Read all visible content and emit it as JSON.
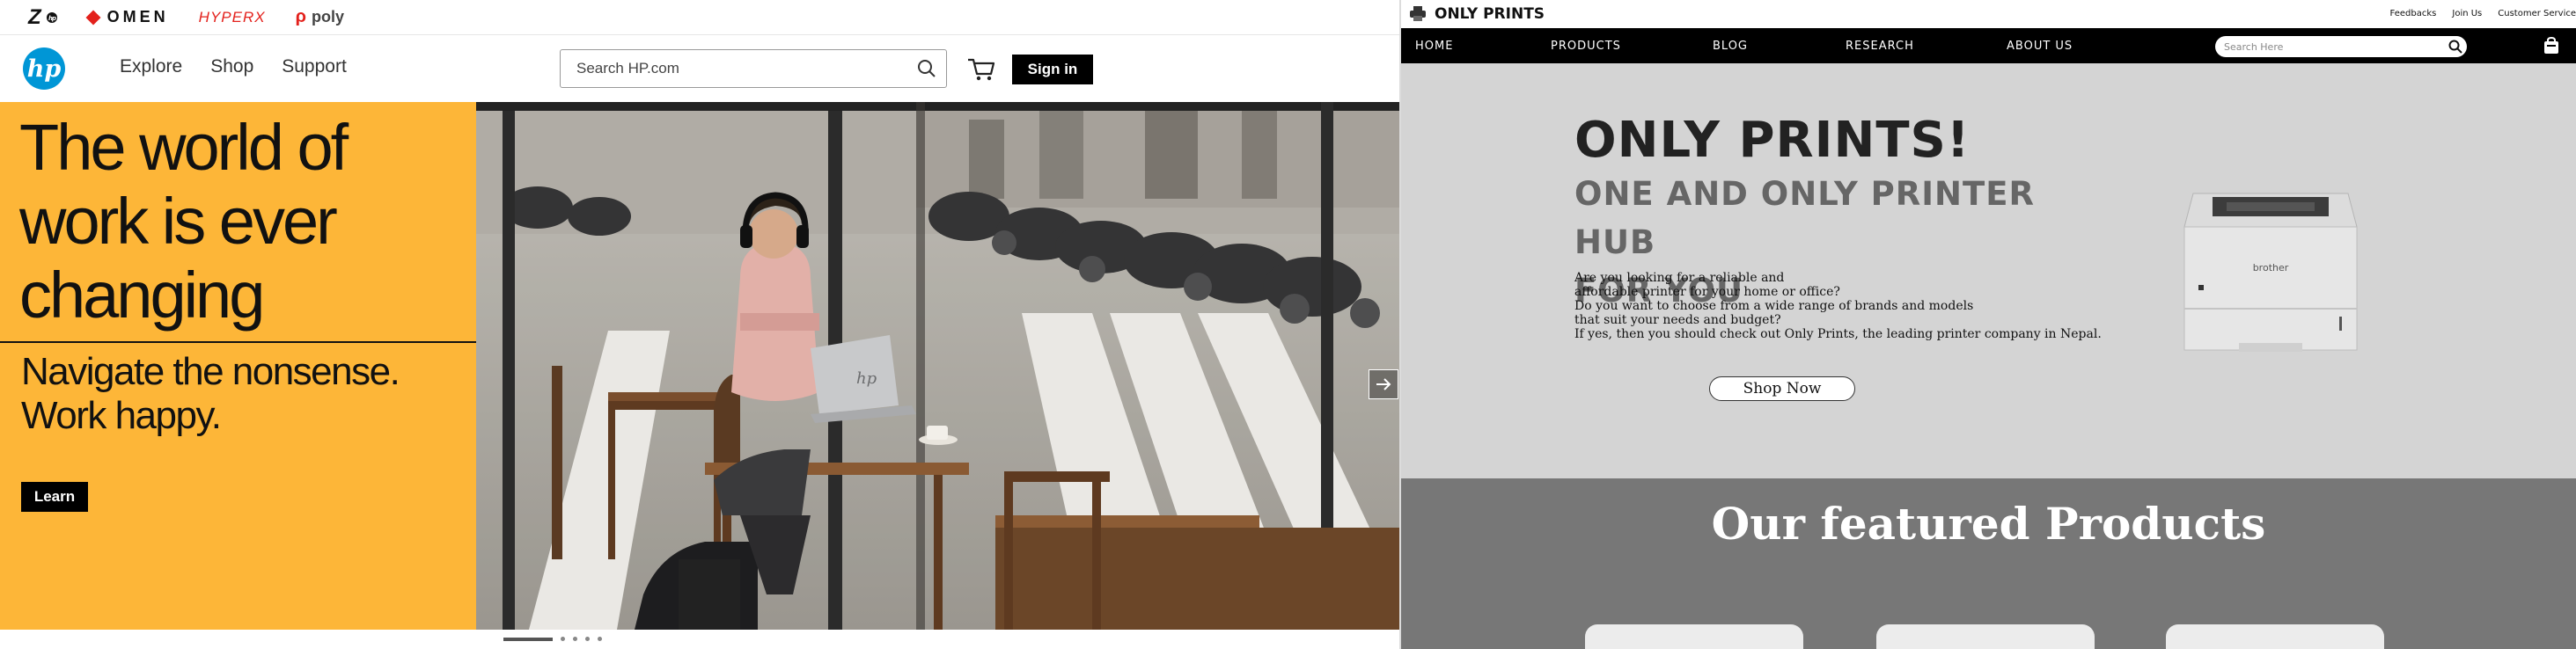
{
  "hp": {
    "brands": {
      "z": "Z",
      "omen": "OMEN",
      "hyperx": "HYPERX",
      "poly": "poly"
    },
    "logo_text": "hp",
    "nav": [
      "Explore",
      "Shop",
      "Support"
    ],
    "search": {
      "placeholder": "Search HP.com"
    },
    "sign_in": "Sign in",
    "hero": {
      "title_lines": [
        "The world of",
        "work is ever",
        "changing"
      ],
      "subtitle_lines": [
        "Navigate the nonsense.",
        "Work happy."
      ],
      "cta": "Learn",
      "laptop_logo": "hp",
      "carousel_total": 5,
      "carousel_active": 1
    },
    "colors": {
      "hero_yellow": "#fdb638",
      "logo_blue": "#0096d6",
      "button_black": "#000000"
    },
    "icons": [
      "search-icon",
      "cart-icon",
      "arrow-right-icon"
    ]
  },
  "onlyprints": {
    "brand": "ONLY PRINTS",
    "top_links": [
      "Feedbacks",
      "Join Us",
      "Customer Service"
    ],
    "nav": [
      "HOME",
      "PRODUCTS",
      "BLOG",
      "RESEARCH",
      "ABOUT US"
    ],
    "search": {
      "placeholder": "Search Here"
    },
    "hero": {
      "title": "ONLY PRINTS!",
      "subtitle_lines": [
        "ONE AND ONLY PRINTER HUB",
        "FOR YOU"
      ],
      "paragraph_lines": [
        "Are you looking for a reliable and",
        "affordable printer for your home or office?",
        "Do you want to choose from a wide range of brands and models",
        "that suit your needs and budget?",
        "If yes, then you should check out Only Prints, the leading printer company in Nepal."
      ],
      "cta": "Shop Now",
      "printer_brand": "brother"
    },
    "featured": {
      "title": "Our featured Products"
    },
    "colors": {
      "nav_black": "#000000",
      "hero_gray": "#d4d4d4",
      "featured_gray": "#777777"
    },
    "icons": [
      "printer-logo-icon",
      "search-icon",
      "cart-icon"
    ]
  }
}
